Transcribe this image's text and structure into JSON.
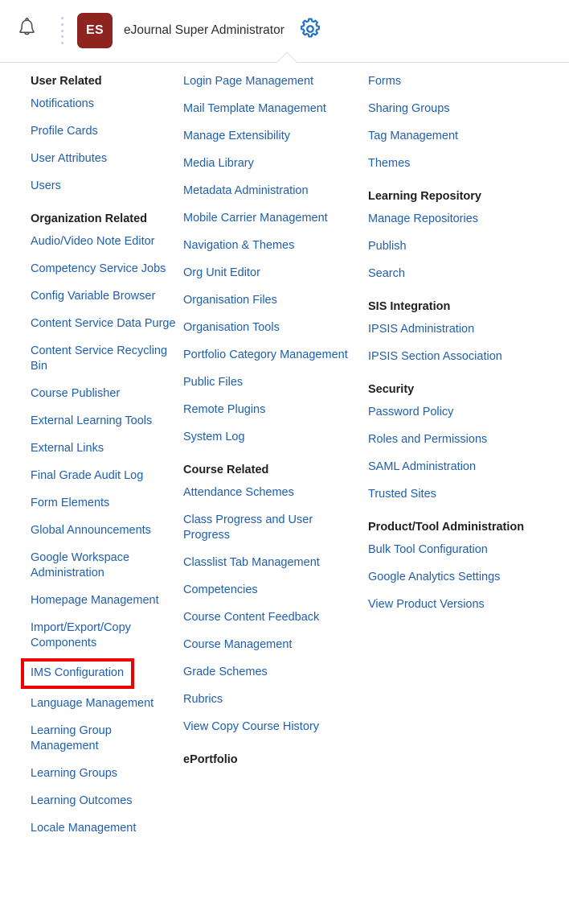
{
  "header": {
    "bell_icon": "bell-icon",
    "separator_icon": "vertical-dots-icon",
    "avatar_initials": "ES",
    "avatar_color": "#8e2420",
    "user_name": "eJournal Super Administrator",
    "gear_icon": "gear-icon",
    "gear_color": "#1f6fc4"
  },
  "theme": {
    "link_color": "#1f5fb0",
    "heading_color": "#1f1f23",
    "highlight_color": "#ee0000",
    "background": "#ffffff"
  },
  "columns": [
    {
      "id": "column-1",
      "sections": [
        {
          "title": "User Related",
          "items": [
            {
              "label": "Notifications"
            },
            {
              "label": "Profile Cards"
            },
            {
              "label": "User Attributes"
            },
            {
              "label": "Users"
            }
          ]
        },
        {
          "title": "Organization Related",
          "items": [
            {
              "label": "Audio/Video Note Editor"
            },
            {
              "label": "Competency Service Jobs"
            },
            {
              "label": "Config Variable Browser"
            },
            {
              "label": "Content Service Data Purge"
            },
            {
              "label": "Content Service Recycling Bin"
            },
            {
              "label": "Course Publisher"
            },
            {
              "label": "External Learning Tools"
            },
            {
              "label": "External Links"
            },
            {
              "label": "Final Grade Audit Log"
            },
            {
              "label": "Form Elements"
            },
            {
              "label": "Global Announcements"
            },
            {
              "label": "Google Workspace Administration"
            },
            {
              "label": "Homepage Management"
            },
            {
              "label": "Import/Export/Copy Components"
            },
            {
              "label": "IMS Configuration",
              "highlighted": true
            },
            {
              "label": "Language Management"
            },
            {
              "label": "Learning Group Management"
            },
            {
              "label": "Learning Groups"
            },
            {
              "label": "Learning Outcomes"
            },
            {
              "label": "Locale Management"
            }
          ]
        }
      ]
    },
    {
      "id": "column-2",
      "sections": [
        {
          "title": "",
          "items": [
            {
              "label": "Login Page Management"
            },
            {
              "label": "Mail Template Management"
            },
            {
              "label": "Manage Extensibility"
            },
            {
              "label": "Media Library"
            },
            {
              "label": "Metadata Administration"
            },
            {
              "label": "Mobile Carrier Management"
            },
            {
              "label": "Navigation & Themes"
            },
            {
              "label": "Org Unit Editor"
            },
            {
              "label": "Organisation Files"
            },
            {
              "label": "Organisation Tools"
            },
            {
              "label": "Portfolio Category Management"
            },
            {
              "label": "Public Files"
            },
            {
              "label": "Remote Plugins"
            },
            {
              "label": "System Log"
            }
          ]
        },
        {
          "title": "Course Related",
          "items": [
            {
              "label": "Attendance Schemes"
            },
            {
              "label": "Class Progress and User Progress"
            },
            {
              "label": "Classlist Tab Management"
            },
            {
              "label": "Competencies"
            },
            {
              "label": "Course Content Feedback"
            },
            {
              "label": "Course Management"
            },
            {
              "label": "Grade Schemes"
            },
            {
              "label": "Rubrics"
            },
            {
              "label": "View Copy Course History"
            }
          ]
        },
        {
          "title": "ePortfolio",
          "items": []
        }
      ]
    },
    {
      "id": "column-3",
      "sections": [
        {
          "title": "",
          "items": [
            {
              "label": "Forms"
            },
            {
              "label": "Sharing Groups"
            },
            {
              "label": "Tag Management"
            },
            {
              "label": "Themes"
            }
          ]
        },
        {
          "title": "Learning Repository",
          "items": [
            {
              "label": "Manage Repositories"
            },
            {
              "label": "Publish"
            },
            {
              "label": "Search"
            }
          ]
        },
        {
          "title": "SIS Integration",
          "items": [
            {
              "label": "IPSIS Administration"
            },
            {
              "label": "IPSIS Section Association"
            }
          ]
        },
        {
          "title": "Security",
          "items": [
            {
              "label": "Password Policy"
            },
            {
              "label": "Roles and Permissions"
            },
            {
              "label": "SAML Administration"
            },
            {
              "label": "Trusted Sites"
            }
          ]
        },
        {
          "title": "Product/Tool Administration",
          "items": [
            {
              "label": "Bulk Tool Configuration"
            },
            {
              "label": "Google Analytics Settings"
            },
            {
              "label": "View Product Versions"
            }
          ]
        }
      ]
    }
  ]
}
